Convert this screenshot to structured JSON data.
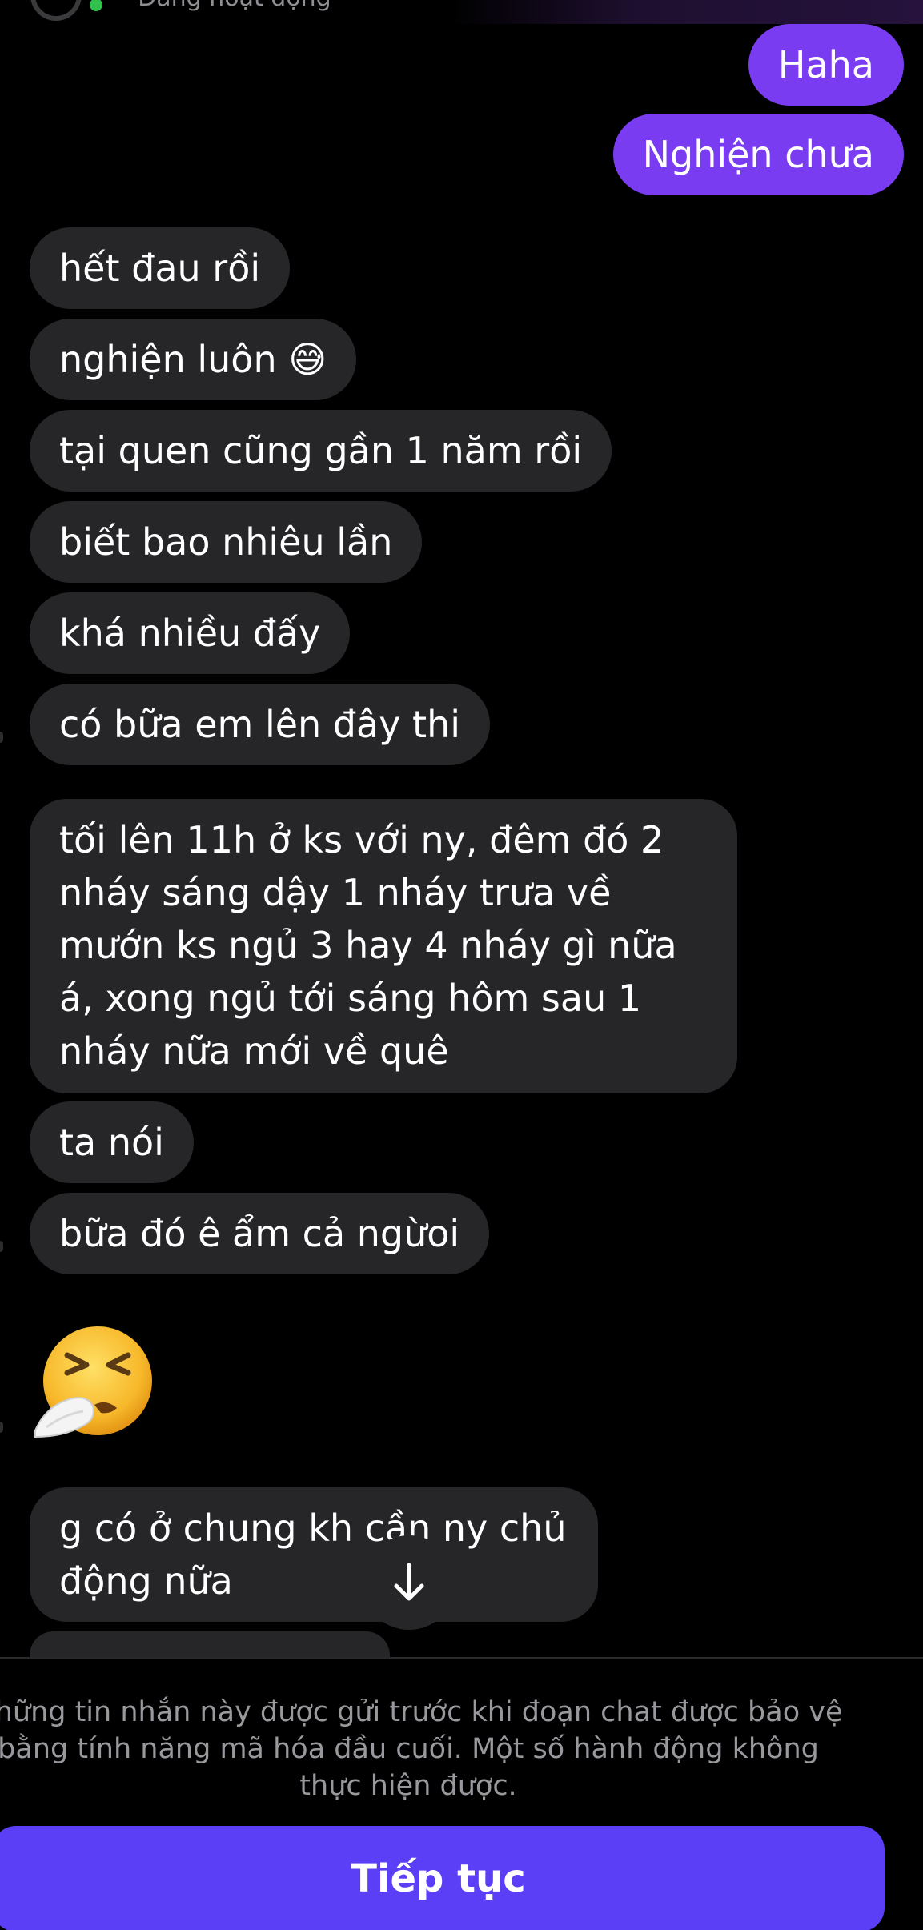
{
  "header": {
    "status_text": "Đang hoạt động"
  },
  "messages": [
    {
      "id": "m1",
      "direction": "out",
      "text": "Haha"
    },
    {
      "id": "m2",
      "direction": "out",
      "text": "Nghiện chưa"
    },
    {
      "id": "m3",
      "direction": "in",
      "text": "hết đau rồi"
    },
    {
      "id": "m4",
      "direction": "in",
      "text": "nghiện luôn 😅"
    },
    {
      "id": "m5",
      "direction": "in",
      "text": "tại quen cũng gần 1 năm rồi"
    },
    {
      "id": "m6",
      "direction": "in",
      "text": "biết bao nhiêu lần"
    },
    {
      "id": "m7",
      "direction": "in",
      "text": "khá nhiều đấy"
    },
    {
      "id": "m8",
      "direction": "in",
      "text": "có bữa em lên đây thi"
    },
    {
      "id": "m9",
      "direction": "in",
      "text": "tối lên 11h ở ks với ny, đêm đó 2 nháy sáng dậy 1 nháy trưa về mướn ks ngủ 3 hay 4 nháy gì nữa á, xong ngủ tới sáng hôm sau 1 nháy nữa mới về quê"
    },
    {
      "id": "m10",
      "direction": "in",
      "text": "ta nói"
    },
    {
      "id": "m11",
      "direction": "in",
      "text": "bữa đó ê ẩm cả ngừoi"
    },
    {
      "id": "m12",
      "direction": "in",
      "emoji": "sneezing-face"
    },
    {
      "id": "m13",
      "direction": "in",
      "text": "g có ở chung kh cần ny chủ động nữa"
    }
  ],
  "scroll_button": {
    "icon": "arrow-down-icon"
  },
  "notice": {
    "text": "Những tin nhắn này được gửi trước khi đoạn chat được bảo vệ bằng tính năng mã hóa đầu cuối. Một số hành động không thực hiện được.",
    "button_label": "Tiếp tục"
  },
  "colors": {
    "background": "#000000",
    "incoming_bubble": "#262628",
    "outgoing_bubble": "#7a3cf0",
    "continue_button": "#5b3ff6",
    "notice_text": "#98989d",
    "online": "#31c24d"
  }
}
